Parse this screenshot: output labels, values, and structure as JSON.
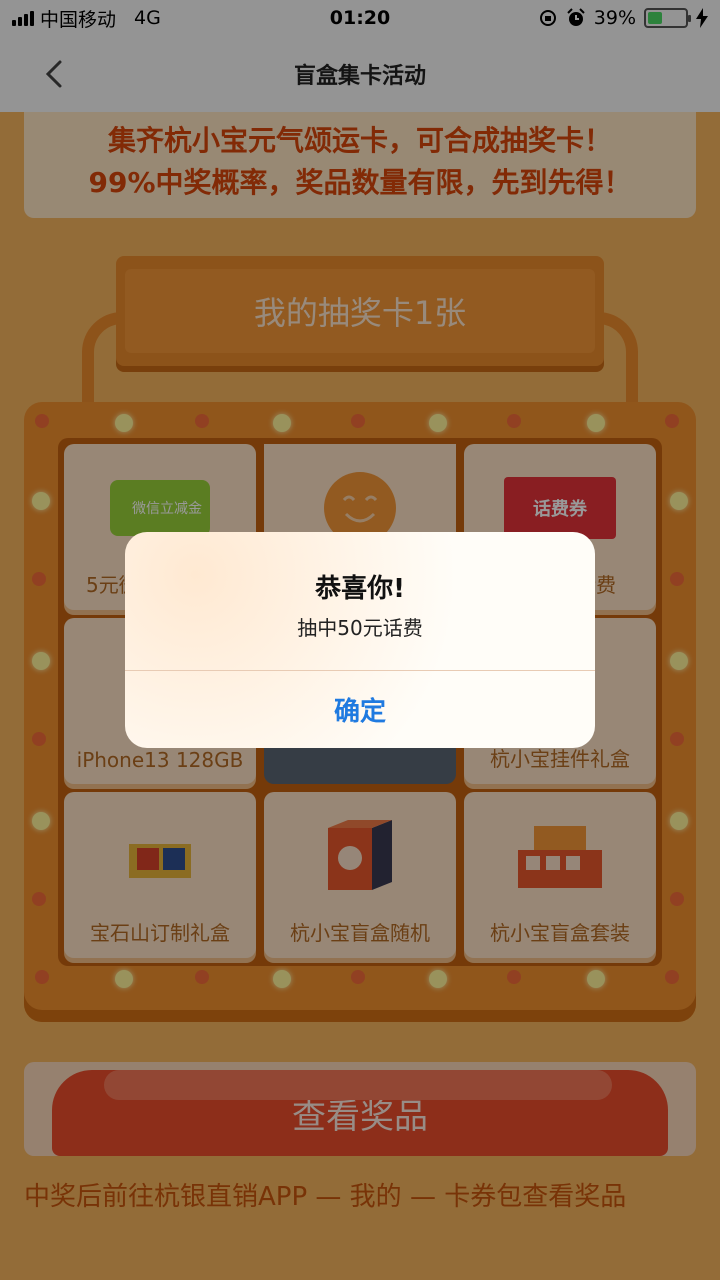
{
  "status_bar": {
    "carrier": "中国移动",
    "network": "4G",
    "time": "01:20",
    "battery_percent": "39%",
    "battery_level": 0.39,
    "icons": [
      "signal-icon",
      "orientation-lock-icon",
      "alarm-icon",
      "battery-icon",
      "charging-icon"
    ]
  },
  "nav": {
    "title": "盲盒集卡活动",
    "back_icon": "chevron-left-icon"
  },
  "banner": {
    "line1": "集齐杭小宝元气颂运卡，可合成抽奖卡！",
    "line2": "99%中奖概率，奖品数量有限，先到先得！"
  },
  "card_header": {
    "label": "我的抽奖卡1张"
  },
  "prizes": [
    {
      "label": "5元微信立减金",
      "badge": "微信立减金"
    },
    {
      "label": "",
      "icon": "smiley-icon"
    },
    {
      "label": "话费",
      "badge": "话费券"
    },
    {
      "label": "iPhone13 128GB"
    },
    {
      "label": ""
    },
    {
      "label": "杭小宝挂件礼盒"
    },
    {
      "label": "宝石山订制礼盒"
    },
    {
      "label": "杭小宝盲盒随机"
    },
    {
      "label": "杭小宝盲盒套装"
    }
  ],
  "cta": {
    "label": "查看奖品"
  },
  "footer_note": "中奖后前往杭银直销APP — 我的 — 卡券包查看奖品",
  "dialog": {
    "title": "恭喜你!",
    "message": "抽中50元话费",
    "confirm": "确定"
  },
  "colors": {
    "accent_orange": "#f08f2e",
    "banner_text": "#d9460a",
    "cta_red": "#eb4d2c",
    "link_blue": "#1f7ae0"
  }
}
